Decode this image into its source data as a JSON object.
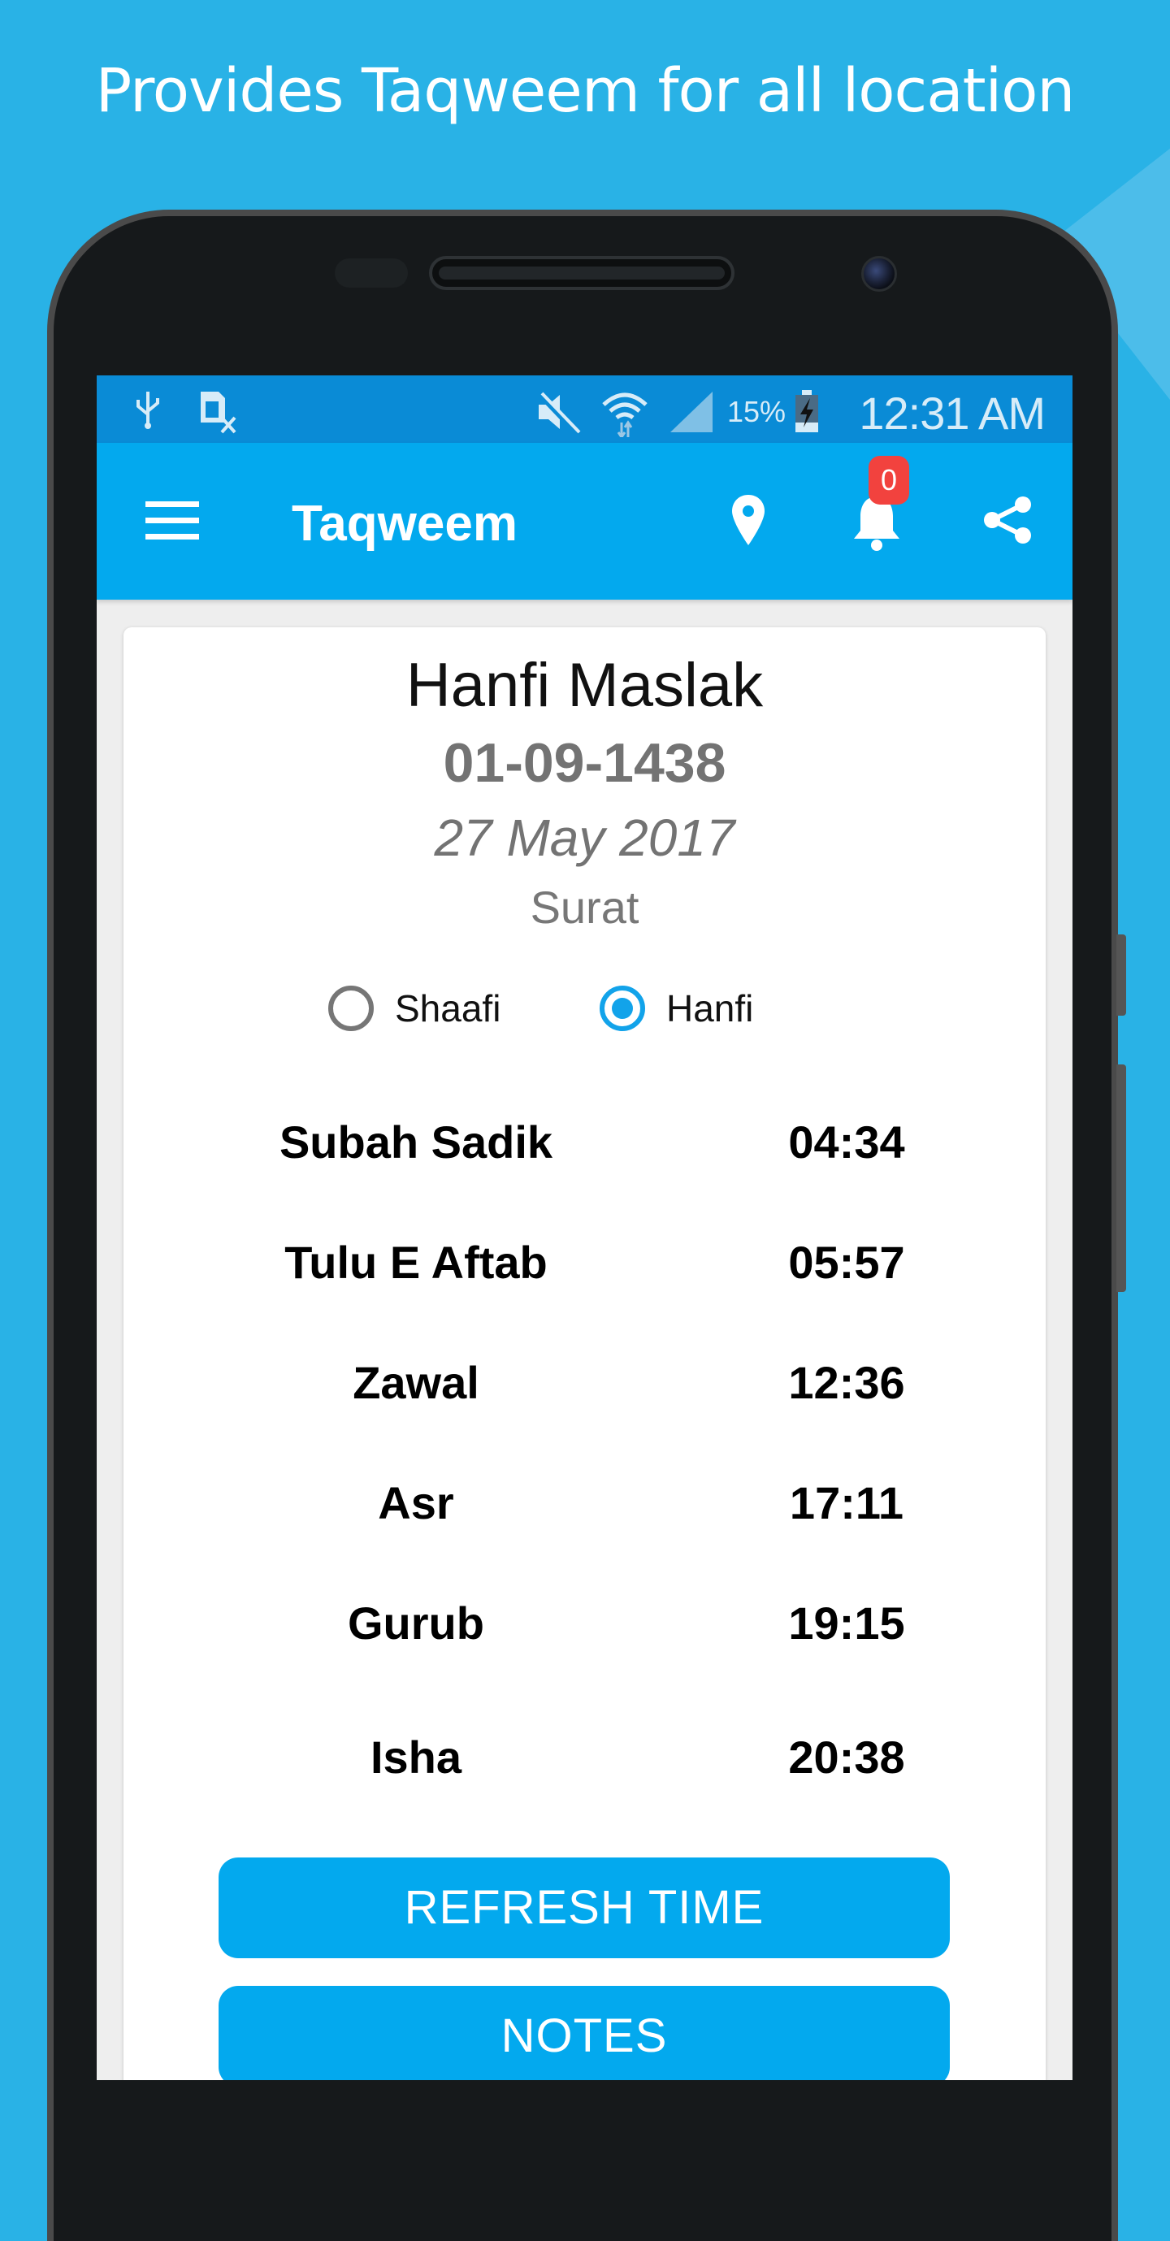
{
  "headline": "Provides Taqweem for all location",
  "status_bar": {
    "icons_left": [
      "usb-icon",
      "no-sim-icon"
    ],
    "icons_right": [
      "mute-icon",
      "wifi-icon",
      "signal-icon",
      "battery-charging-icon"
    ],
    "battery_percent": "15%",
    "time": "12:31 AM"
  },
  "app_bar": {
    "title": "Taqweem",
    "notification_count": "0",
    "icons": [
      "menu-icon",
      "location-pin-icon",
      "bell-icon",
      "share-icon"
    ]
  },
  "card": {
    "title": "Hanfi Maslak",
    "hijri_date": "01-09-1438",
    "gregorian_date": "27 May 2017",
    "city": "Surat",
    "maslak_options": [
      {
        "label": "Shaafi",
        "selected": false
      },
      {
        "label": "Hanfi",
        "selected": true
      }
    ],
    "prayer_times": [
      {
        "name": "Subah Sadik",
        "time": "04:34"
      },
      {
        "name": "Tulu E Aftab",
        "time": "05:57"
      },
      {
        "name": "Zawal",
        "time": "12:36"
      },
      {
        "name": "Asr",
        "time": "17:11"
      },
      {
        "name": "Gurub",
        "time": "19:15"
      },
      {
        "name": "Isha",
        "time": "20:38"
      }
    ],
    "buttons": {
      "refresh": "REFRESH TIME",
      "notes": "NOTES"
    }
  },
  "colors": {
    "background": "#29B2E6",
    "status_bar": "#0A8BD6",
    "app_bar": "#03A9EE",
    "accent": "#12A3EA",
    "badge": "#F2423E"
  }
}
